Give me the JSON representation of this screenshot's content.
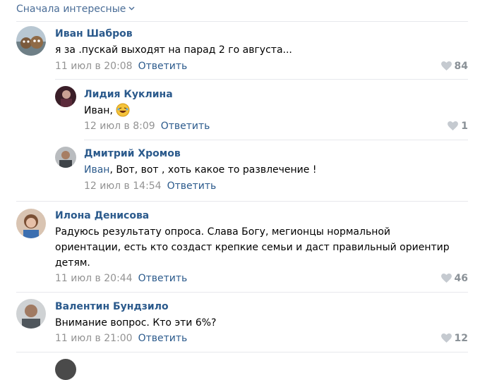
{
  "sort_label": "Сначала интересные",
  "comments": [
    {
      "name": "Иван Шабров",
      "text": "я за .пускай выходят на парад 2 го августа...",
      "date": "11 июл в 20:08",
      "reply": "Ответить",
      "likes": "84"
    },
    {
      "name": "Лидия Куклина",
      "text": "Иван,",
      "date": "12 июл в 8:09",
      "reply": "Ответить",
      "likes": "1"
    },
    {
      "name": "Дмитрий Хромов",
      "mention": "Иван",
      "text": ", Вот, вот , хоть какое то развлечение !",
      "date": "12 июл в 14:54",
      "reply": "Ответить"
    },
    {
      "name": "Илона Денисова",
      "text_lines": [
        "Радуюсь результату опроса. Слава Богу, мегионцы нормальной",
        "ориентации, есть кто создаст крепкие семьи и даст правильный ориентир",
        "детям."
      ],
      "date": "11 июл в 20:44",
      "reply": "Ответить",
      "likes": "46"
    },
    {
      "name": "Валентин Бундзило",
      "text": "Внимание вопрос. Кто эти 6%?",
      "date": "11 июл в 21:00",
      "reply": "Ответить",
      "likes": "12"
    }
  ]
}
